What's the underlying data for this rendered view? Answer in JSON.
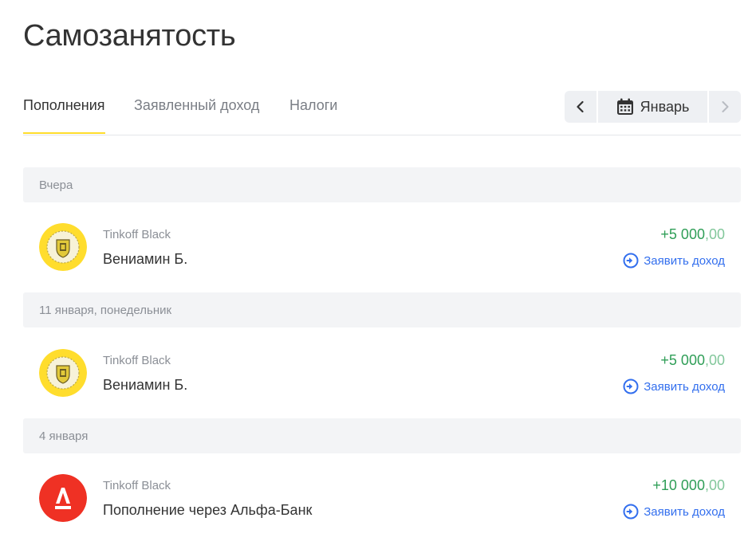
{
  "page": {
    "title": "Самозанятость"
  },
  "tabs": [
    {
      "label": "Пополнения",
      "active": true
    },
    {
      "label": "Заявленный доход",
      "active": false
    },
    {
      "label": "Налоги",
      "active": false
    }
  ],
  "month_nav": {
    "month": "Январь",
    "prev_icon": "chevron-left-icon",
    "next_icon": "chevron-right-icon",
    "calendar_icon": "calendar-icon"
  },
  "groups": [
    {
      "date": "Вчера",
      "transactions": [
        {
          "source": "Tinkoff Black",
          "name": "Вениамин Б.",
          "amount_main": "+5 000",
          "amount_dec": ",00",
          "action": "Заявить доход",
          "bank_icon": "tinkoff-logo-icon"
        }
      ]
    },
    {
      "date": "11 января, понедельник",
      "transactions": [
        {
          "source": "Tinkoff Black",
          "name": "Вениамин Б.",
          "amount_main": "+5 000",
          "amount_dec": ",00",
          "action": "Заявить доход",
          "bank_icon": "tinkoff-logo-icon"
        }
      ]
    },
    {
      "date": "4 января",
      "transactions": [
        {
          "source": "Tinkoff Black",
          "name": "Пополнение через Альфа-Банк",
          "amount_main": "+10 000",
          "amount_dec": ",00",
          "action": "Заявить доход",
          "bank_icon": "alfa-bank-logo-icon"
        }
      ]
    }
  ],
  "colors": {
    "accent_yellow": "#ffdd2d",
    "income_green": "#2f9e57",
    "link_blue": "#336fee",
    "alfa_red": "#ef3124"
  }
}
